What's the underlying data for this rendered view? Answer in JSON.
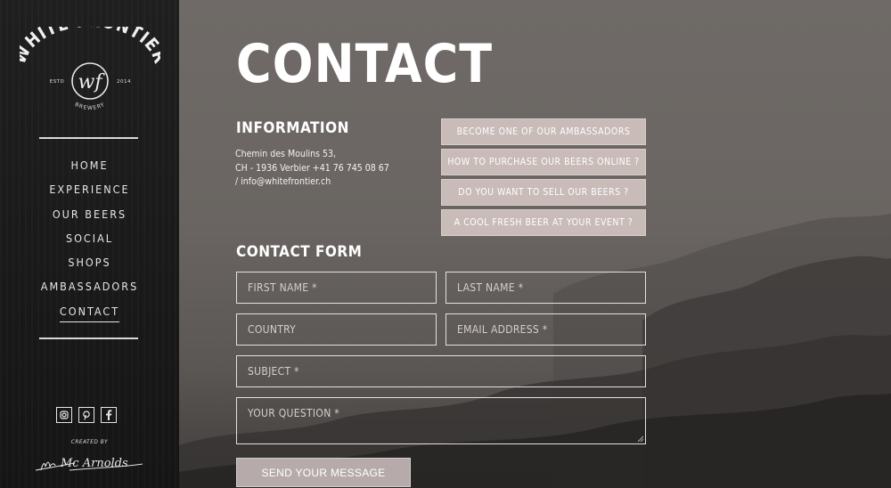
{
  "brand": {
    "name": "WHITE FRONTIER",
    "monogram": "wf",
    "estd": "ESTD",
    "year": "2014",
    "sub": "BREWERY"
  },
  "nav": {
    "items": [
      {
        "label": "HOME"
      },
      {
        "label": "EXPERIENCE"
      },
      {
        "label": "OUR BEERS"
      },
      {
        "label": "SOCIAL"
      },
      {
        "label": "SHOPS"
      },
      {
        "label": "AMBASSADORS"
      },
      {
        "label": "CONTACT",
        "active": true
      }
    ]
  },
  "social": {
    "instagram": "instagram-icon",
    "pinterest": "pinterest-icon",
    "facebook": "facebook-icon"
  },
  "credits": {
    "created_by": "CREATED BY",
    "author": "Mc Arnolds"
  },
  "page": {
    "title": "CONTACT"
  },
  "information": {
    "title": "INFORMATION",
    "line1": "Chemin des Moulins 53,",
    "line2": "CH - 1936 Verbier +41 76 745 08 67",
    "line3": "/ info@whitefrontier.ch"
  },
  "cta": {
    "ambassador": "BECOME ONE OF OUR AMBASSADORS",
    "purchase": "HOW TO PURCHASE OUR BEERS ONLINE ?",
    "sell": "DO YOU WANT TO SELL OUR BEERS ?",
    "event": "A COOL FRESH BEER AT YOUR EVENT ?"
  },
  "form": {
    "title": "CONTACT FORM",
    "first_name": "FIRST NAME *",
    "last_name": "LAST NAME *",
    "country": "COUNTRY",
    "email": "EMAIL ADDRESS *",
    "subject": "SUBJECT *",
    "question": "YOUR QUESTION *",
    "submit": "SEND YOUR MESSAGE"
  },
  "colors": {
    "sidebar_bg": "#1a1a1a",
    "button_bg": "#c8bbb8",
    "text": "#ffffff"
  }
}
